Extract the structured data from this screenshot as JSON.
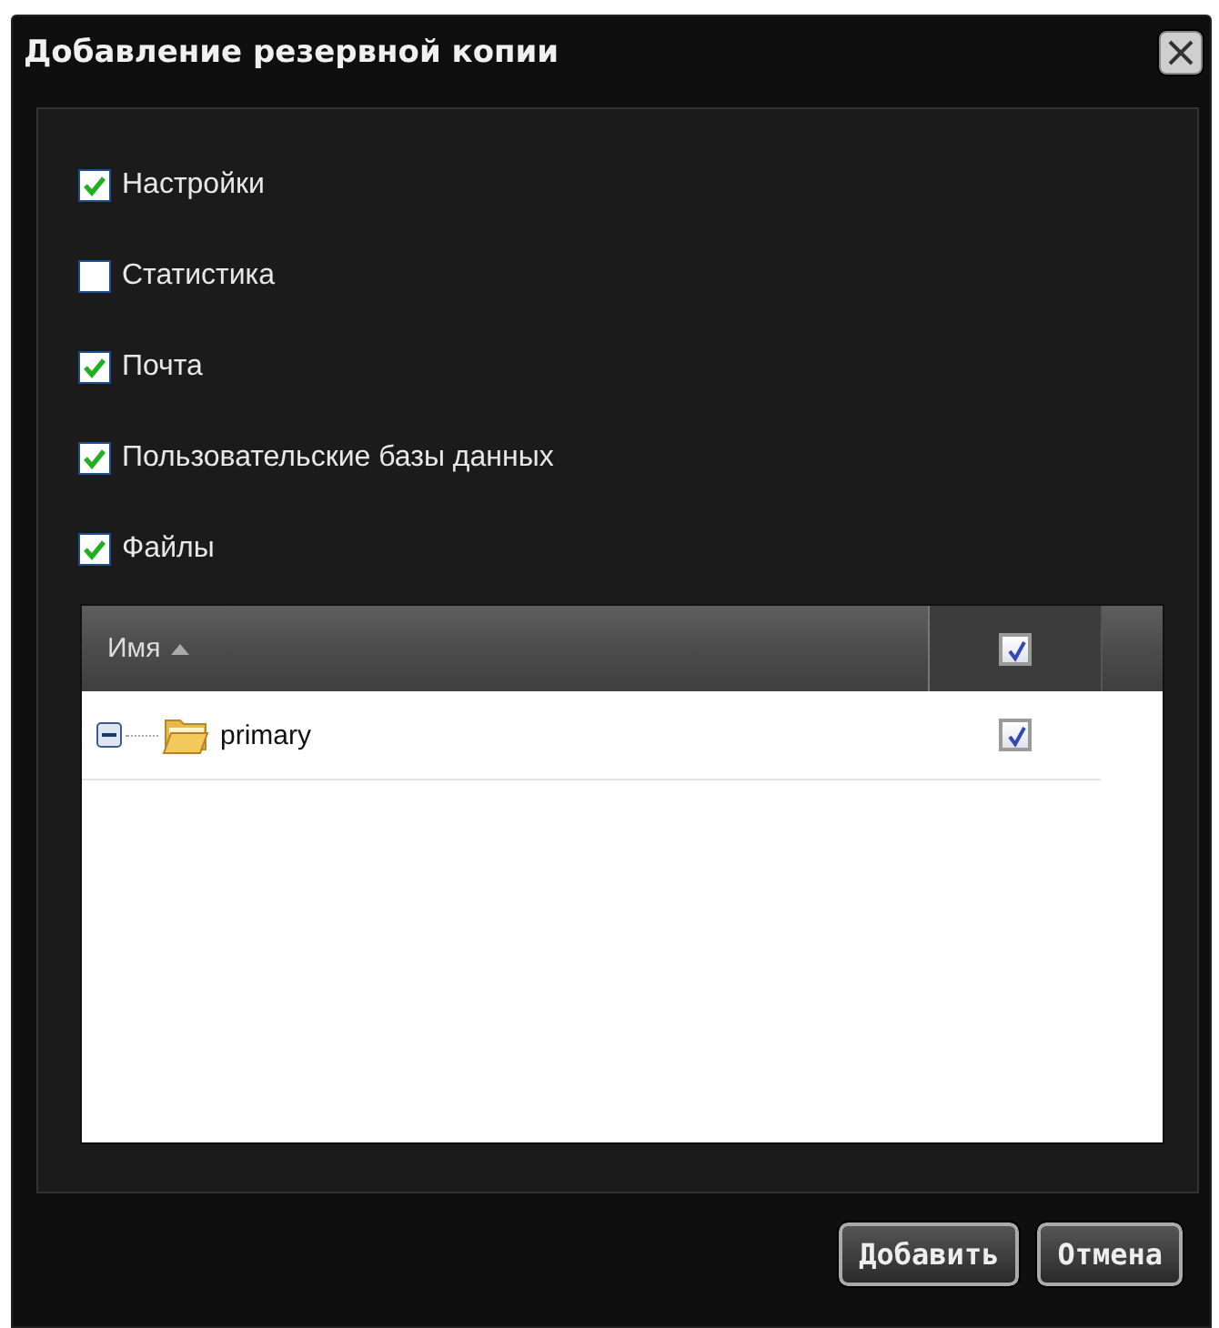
{
  "window": {
    "title": "Добавление резервной копии"
  },
  "options": [
    {
      "label": "Настройки",
      "checked": true
    },
    {
      "label": "Статистика",
      "checked": false
    },
    {
      "label": "Почта",
      "checked": true
    },
    {
      "label": "Пользовательские базы данных",
      "checked": true
    },
    {
      "label": "Файлы",
      "checked": true
    }
  ],
  "grid": {
    "columns": [
      {
        "label": "Имя",
        "sort_ascending": true
      },
      {
        "kind": "checkbox",
        "checked": true
      }
    ],
    "rows": [
      {
        "label": "primary",
        "expanded": true,
        "checked": true
      }
    ]
  },
  "buttons": [
    "Добавить",
    "Отмена"
  ]
}
